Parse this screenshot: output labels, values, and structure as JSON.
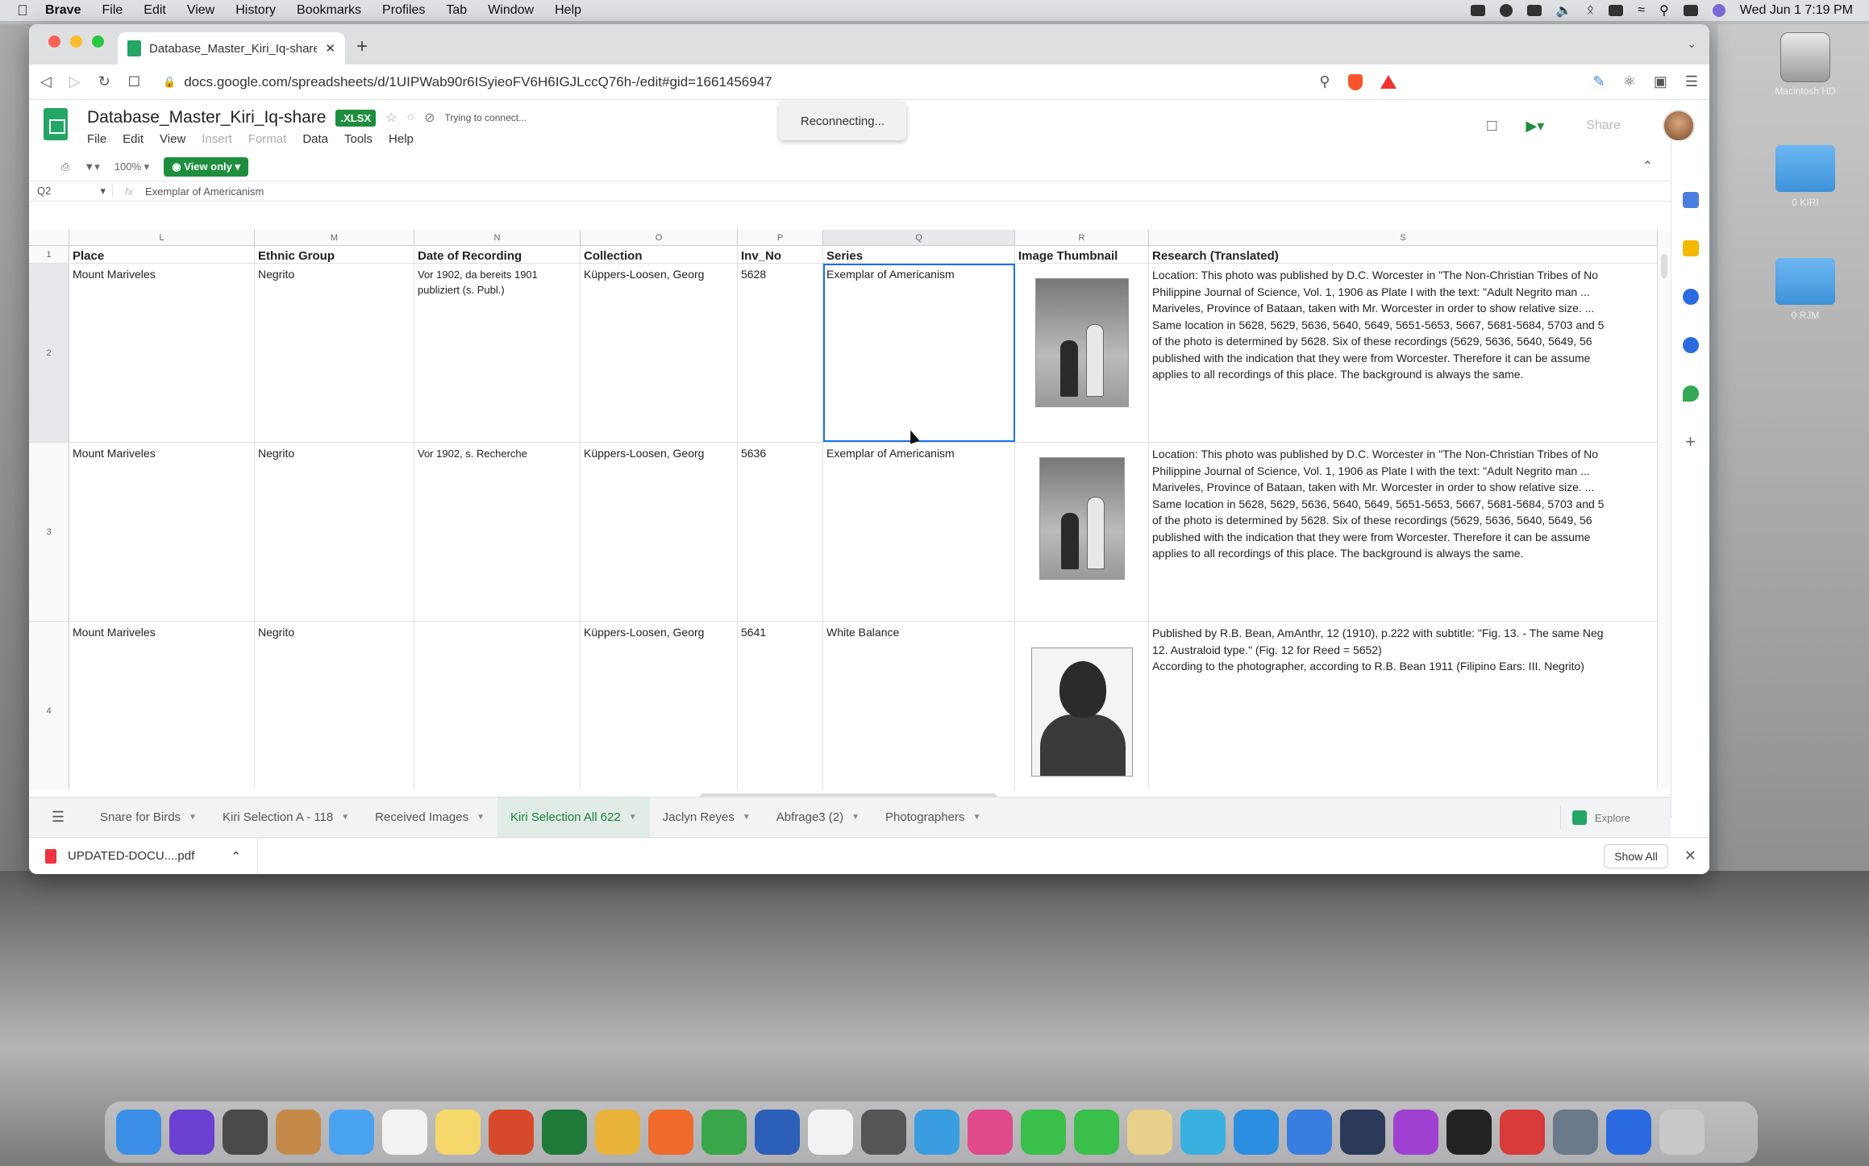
{
  "menubar": {
    "app": "Brave",
    "items": [
      "File",
      "Edit",
      "View",
      "History",
      "Bookmarks",
      "Profiles",
      "Tab",
      "Window",
      "Help"
    ],
    "clock": "Wed Jun 1  7:19 PM"
  },
  "desktop": {
    "icons": [
      {
        "label": "Macintosh HD"
      },
      {
        "label": "0 KIRI"
      },
      {
        "label": "0 RJM"
      }
    ]
  },
  "browser": {
    "tab_title": "Database_Master_Kiri_Iq-share",
    "url": "docs.google.com/spreadsheets/d/1UIPWab90r6ISyieoFV6H6IGJLccQ76h-/edit#gid=1661456947"
  },
  "sheets": {
    "doc_title": "Database_Master_Kiri_Iq-share",
    "badge": ".XLSX",
    "connection_status": "Trying to connect...",
    "menu": [
      "File",
      "Edit",
      "View",
      "Insert",
      "Format",
      "Data",
      "Tools",
      "Help"
    ],
    "share_label": "Share",
    "toast": "Reconnecting...",
    "zoom": "100%",
    "view_only": "View only",
    "cell_ref": "Q2",
    "formula_value": "Exemplar of Americanism",
    "column_letters": [
      "L",
      "M",
      "N",
      "O",
      "P",
      "Q",
      "R",
      "S"
    ],
    "headers": [
      "Place",
      "Ethnic Group",
      "Date of Recording",
      "Collection",
      "Inv_No",
      "Series",
      "Image Thumbnail",
      "Research (Translated)"
    ],
    "rows": [
      {
        "num": "2",
        "place": "Mount Mariveles",
        "ethnic": "Negrito",
        "date": "Vor 1902, da bereits 1901 publiziert (s. Publ.)",
        "collection": "Küppers-Loosen, Georg",
        "inv": "5628",
        "series": "Exemplar of Americanism",
        "research": [
          "Location: This photo was published by D.C. Worcester in \"The Non-Christian Tribes of No",
          "Philippine Journal of Science, Vol. 1, 1906 as Plate I with the text: \"Adult Negrito man ...",
          "Mariveles, Province of Bataan, taken with Mr. Worcester in order to show relative size. ...",
          "Same location in 5628, 5629, 5636, 5640, 5649, 5651-5653, 5667, 5681-5684, 5703 and 5",
          "of the photo is determined by 5628. Six of these recordings (5629, 5636, 5640, 5649, 56",
          "published with the indication that they were from Worcester. Therefore it can be assume",
          "applies to all recordings of this place. The background is always the same."
        ]
      },
      {
        "num": "3",
        "place": "Mount Mariveles",
        "ethnic": "Negrito",
        "date": "Vor 1902, s. Recherche",
        "collection": "Küppers-Loosen, Georg",
        "inv": "5636",
        "series": "Exemplar of Americanism",
        "research": [
          "Location: This photo was published by D.C. Worcester in \"The Non-Christian Tribes of No",
          "Philippine Journal of Science, Vol. 1, 1906 as Plate I with the text: \"Adult Negrito man ...",
          "Mariveles, Province of Bataan, taken with Mr. Worcester in order to show relative size. ...",
          "Same location in 5628, 5629, 5636, 5640, 5649, 5651-5653, 5667, 5681-5684, 5703 and 5",
          "of the photo is determined by 5628. Six of these recordings (5629, 5636, 5640, 5649, 56",
          "published with the indication that they were from Worcester. Therefore it can be assume",
          "applies to all recordings of this place. The background is always the same."
        ]
      },
      {
        "num": "4",
        "place": "Mount Mariveles",
        "ethnic": "Negrito",
        "date": "",
        "collection": "Küppers-Loosen, Georg",
        "inv": "5641",
        "series": "White Balance",
        "research": [
          "Published by R.B. Bean, AmAnthr, 12 (1910), p.222 with subtitle: \"Fig. 13. - The same Neg",
          "12. Australoid type.\" (Fig. 12 for Reed = 5652)",
          "According to the photographer, according to R.B. Bean 1911 (Filipino Ears: III. Negrito)"
        ]
      }
    ],
    "sheet_tabs": [
      "Snare for Birds",
      "Kiri Selection A - 118",
      "Received Images",
      "Kiri Selection All 622",
      "Jaclyn Reyes",
      "Abfrage3 (2)",
      "Photographers"
    ],
    "active_tab": "Kiri Selection All 622",
    "explore_label": "Explore"
  },
  "download": {
    "file": "UPDATED-DOCU....pdf",
    "show_all": "Show All"
  },
  "dock": {
    "colors": [
      "#3a8ee6",
      "#6a3fd1",
      "#4a4a4a",
      "#c58a4a",
      "#4aa3f0",
      "#f2f2f2",
      "#f5d86b",
      "#d64a2b",
      "#1f7a3a",
      "#e9b33a",
      "#f06a2b",
      "#3aa64a",
      "#2b5fb8",
      "#f2f2f2",
      "#555",
      "#3a9de0",
      "#e04a8a",
      "#3ac04a",
      "#3ac04a",
      "#e8d08a",
      "#3ab0e0",
      "#2b8ee0",
      "#3a7de0",
      "#2b3a5a",
      "#a040d0",
      "#222",
      "#d93a3a",
      "#6a7a8a",
      "#2b6ae0",
      "#c8c8c8"
    ]
  }
}
